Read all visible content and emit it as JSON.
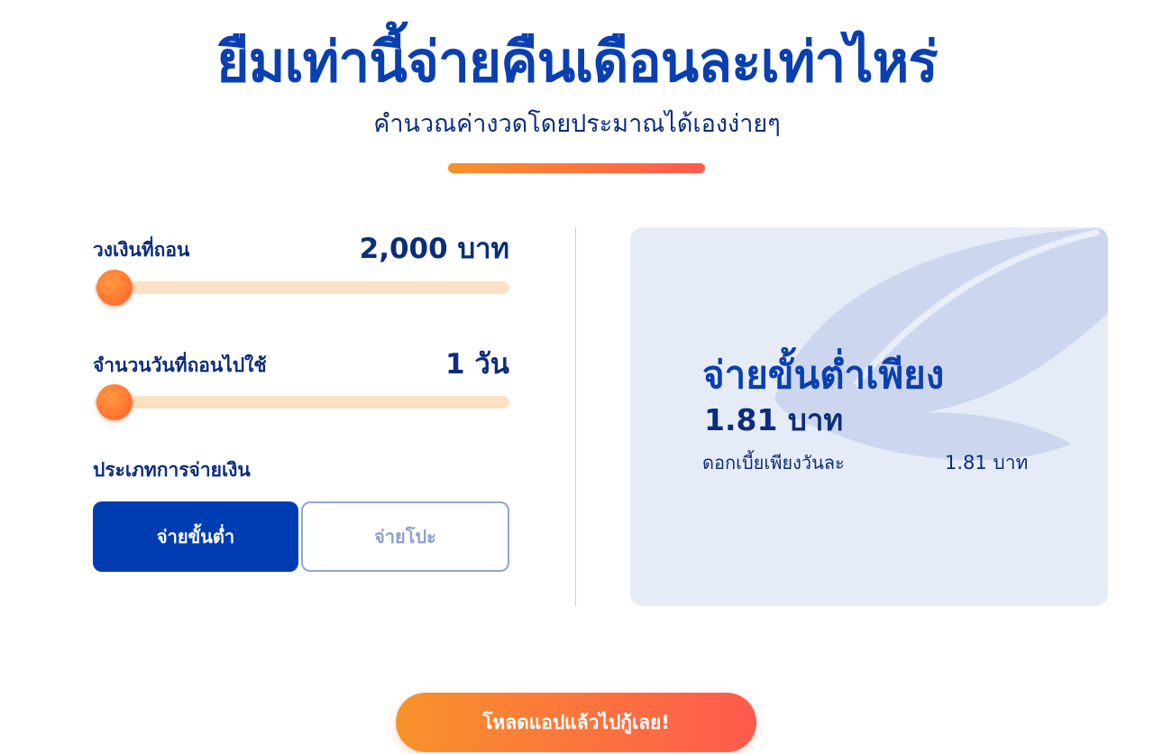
{
  "header": {
    "title": "ยืมเท่านี้จ่ายคืนเดือนละเท่าไหร่",
    "subtitle": "คำนวณค่างวดโดยประมาณได้เองง่ายๆ"
  },
  "calculator": {
    "amount": {
      "label": "วงเงินที่ถอน",
      "value": "2,000 บาท",
      "slider_level": 0
    },
    "days": {
      "label": "จำนวนวันที่ถอนไปใช้",
      "value": "1 วัน",
      "slider_level": 0
    },
    "payment_type": {
      "label": "ประเภทการจ่ายเงิน",
      "options": [
        "จ่ายขั้นต่ำ",
        "จ่ายโปะ"
      ],
      "selected": "จ่ายขั้นต่ำ"
    }
  },
  "result": {
    "heading": "จ่ายขั้นต่ำเพียง",
    "amount": "1.81 บาท",
    "interest_label": "ดอกเบี้ยเพียงวันละ",
    "interest_value": "1.81 บาท"
  },
  "cta": {
    "label": "โหลดแอปแล้วไปกู้เลย!"
  },
  "colors": {
    "primary": "#0a3fb0",
    "navy": "#0b2d7a",
    "accent_start": "#f7922a",
    "accent_end": "#ff5a4e",
    "card_bg": "#e6ecf7"
  }
}
